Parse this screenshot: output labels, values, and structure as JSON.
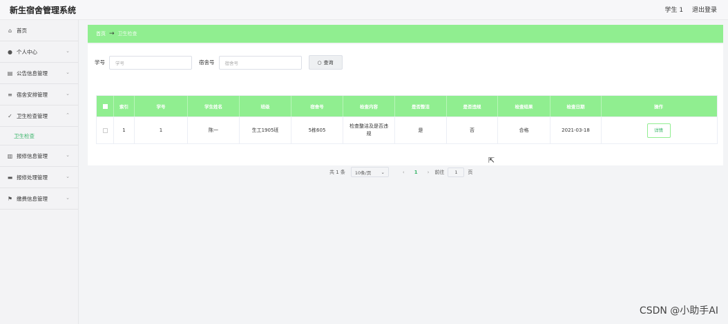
{
  "header": {
    "title": "新生宿舍管理系统",
    "user": "学生 1",
    "logout": "退出登录"
  },
  "sidebar": {
    "items": [
      {
        "label": "首页",
        "icon": "home-icon",
        "chev": false
      },
      {
        "label": "个人中心",
        "icon": "user-icon",
        "chev": true
      },
      {
        "label": "公告信息管理",
        "icon": "clipboard-icon",
        "chev": true
      },
      {
        "label": "宿舍安排管理",
        "icon": "list-icon",
        "chev": true
      },
      {
        "label": "卫生检查管理",
        "icon": "check-icon",
        "chev": true,
        "expanded": true
      },
      {
        "label": "报修信息管理",
        "icon": "chart-icon",
        "chev": true
      },
      {
        "label": "报修处理管理",
        "icon": "monitor-icon",
        "chev": true
      },
      {
        "label": "缴费信息管理",
        "icon": "flag-icon",
        "chev": true
      }
    ],
    "sub_item": "卫生检查"
  },
  "breadcrumb": {
    "home": "首页",
    "current": "卫生检查"
  },
  "search": {
    "student_id_label": "学号",
    "student_id_placeholder": "学号",
    "dorm_label": "宿舍号",
    "dorm_placeholder": "宿舍号",
    "query_button": "查询"
  },
  "table": {
    "columns": [
      "索引",
      "学号",
      "学生姓名",
      "班级",
      "宿舍号",
      "检查内容",
      "是否整洁",
      "是否违规",
      "检查结果",
      "检查日期",
      "操作"
    ],
    "rows": [
      {
        "index": "1",
        "student_id": "1",
        "name": "陈一",
        "class": "生工1905班",
        "dorm": "5栋605",
        "content": "检查整洁及是否违规",
        "tidy": "是",
        "violation": "否",
        "result": "合格",
        "date": "2021-03-18",
        "action": "详情"
      }
    ]
  },
  "pagination": {
    "total": "共 1 条",
    "page_size": "10条/页",
    "current_page": "1",
    "goto_label": "前往",
    "goto_value": "1",
    "page_suffix": "页"
  },
  "watermark": "CSDN @小助手AI",
  "colors": {
    "accent": "#90ee90",
    "accent_text": "#3ab56a"
  }
}
